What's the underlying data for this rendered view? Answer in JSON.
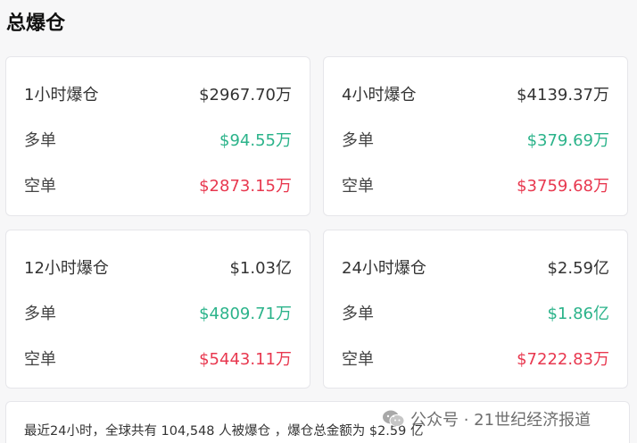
{
  "title": "总爆仓",
  "cards": [
    {
      "period": "1小时爆仓",
      "total": "$2967.70万",
      "long_label": "多单",
      "long": "$94.55万",
      "short_label": "空单",
      "short": "$2873.15万"
    },
    {
      "period": "4小时爆仓",
      "total": "$4139.37万",
      "long_label": "多单",
      "long": "$379.69万",
      "short_label": "空单",
      "short": "$3759.68万"
    },
    {
      "period": "12小时爆仓",
      "total": "$1.03亿",
      "long_label": "多单",
      "long": "$4809.71万",
      "short_label": "空单",
      "short": "$5443.11万"
    },
    {
      "period": "24小时爆仓",
      "total": "$2.59亿",
      "long_label": "多单",
      "long": "$1.86亿",
      "short_label": "空单",
      "short": "$7222.83万"
    }
  ],
  "footer": "最近24小时，全球共有 104,548 人被爆仓 ，爆仓总金额为 $2.59 亿",
  "watermark": "公众号 · 21世纪经济报道",
  "colors": {
    "long": "#2bb38a",
    "short": "#e8384f"
  }
}
